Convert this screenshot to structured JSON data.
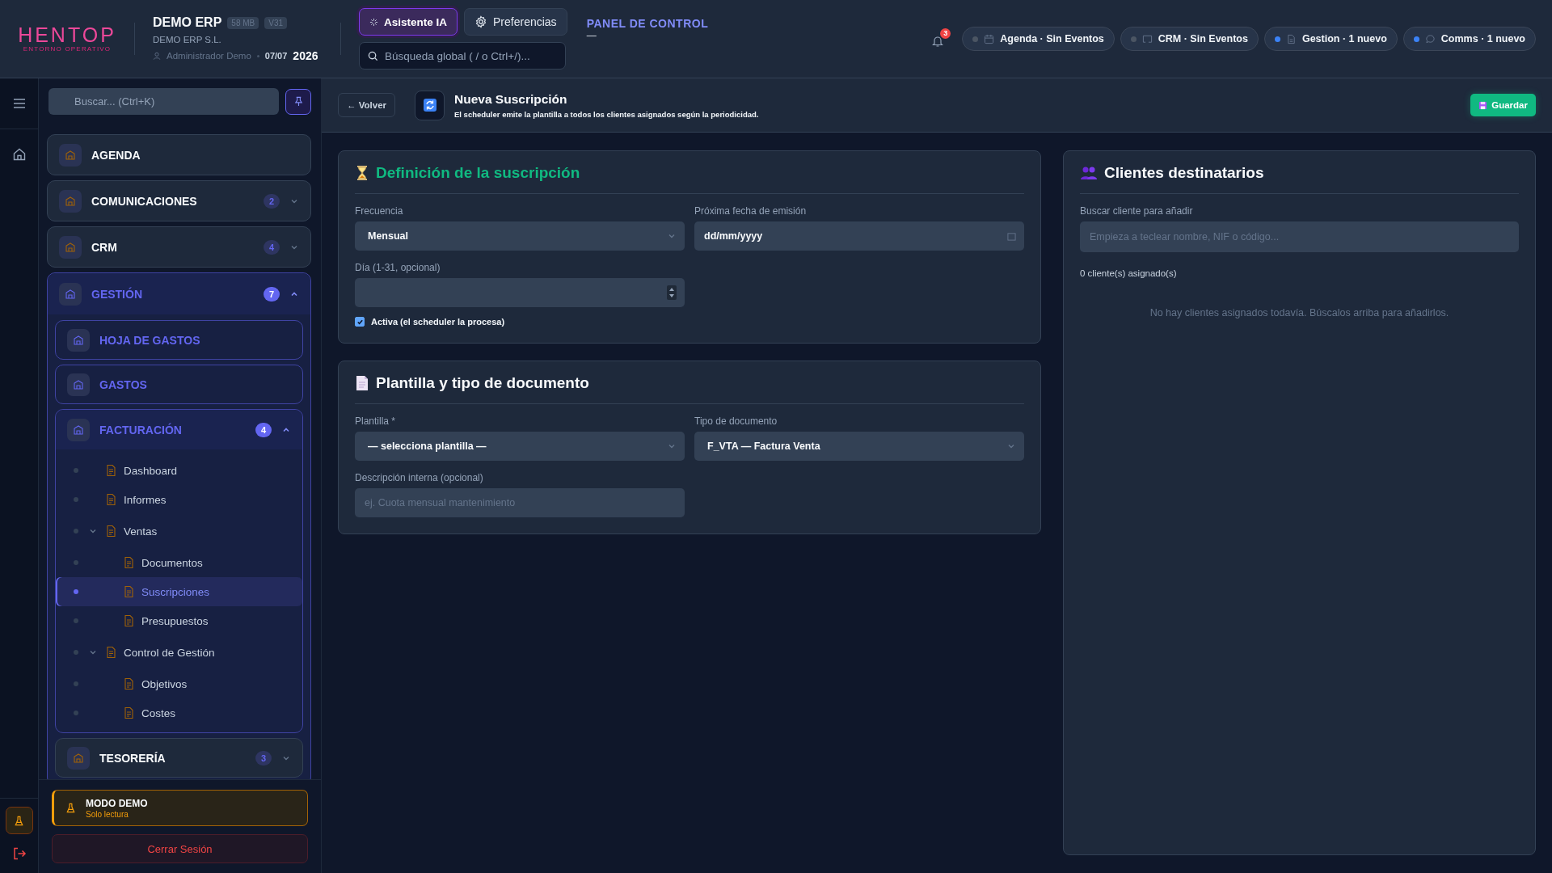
{
  "header": {
    "logo": {
      "name": "HENTOP",
      "tagline": "ENTORNO OPERATIVO"
    },
    "company": {
      "name": "DEMO ERP",
      "badges": [
        "58 MB",
        "V31"
      ],
      "legal_name": "DEMO ERP S.L.",
      "user": "Administrador Demo",
      "date": "07/07",
      "year": "2026"
    },
    "buttons": [
      {
        "label": "Asistente IA",
        "selected": true
      },
      {
        "label": "Preferencias",
        "selected": false
      }
    ],
    "search": {
      "placeholder": "Búsqueda global ( / o Ctrl+/)..."
    },
    "panel_title": "PANEL DE CONTROL",
    "panel_subtitle": "—",
    "notifications": {
      "count": "3"
    },
    "chips": [
      {
        "label": "Agenda · Sin Eventos",
        "color": "#4b5563",
        "kind": "calendar"
      },
      {
        "label": "CRM · Sin Eventos",
        "color": "#4b5563",
        "kind": "screen"
      },
      {
        "label": "Gestion · 1 nuevo",
        "color": "#3b82f6",
        "kind": "document"
      },
      {
        "label": "Comms · 1 nuevo",
        "color": "#3b82f6",
        "kind": "chat"
      }
    ]
  },
  "sidebar": {
    "search": {
      "placeholder": "Buscar... (Ctrl+K)"
    },
    "items": [
      {
        "kind": "section",
        "label": "AGENDA",
        "highlighted": false
      },
      {
        "kind": "section",
        "label": "COMUNICACIONES",
        "badge": "2",
        "expanded": false,
        "highlighted": false
      },
      {
        "kind": "section",
        "label": "CRM",
        "badge": "4",
        "expanded": false,
        "highlighted": false
      },
      {
        "kind": "section",
        "label": "GESTIÓN",
        "badge": "7",
        "expanded": true,
        "highlighted": true,
        "children": [
          {
            "kind": "section",
            "label": "HOJA DE GASTOS",
            "highlighted": true
          },
          {
            "kind": "section",
            "label": "GASTOS",
            "highlighted": true
          },
          {
            "kind": "section",
            "label": "FACTURACIÓN",
            "badge": "4",
            "expanded": true,
            "highlighted": true,
            "children": [
              {
                "kind": "link",
                "label": "Dashboard",
                "selected": false
              },
              {
                "kind": "link",
                "label": "Informes",
                "selected": false
              },
              {
                "kind": "link",
                "label": "Ventas",
                "selected": false,
                "expanded": true,
                "children": [
                  {
                    "kind": "link",
                    "label": "Documentos",
                    "selected": false
                  },
                  {
                    "kind": "link",
                    "label": "Suscripciones",
                    "selected": true
                  },
                  {
                    "kind": "link",
                    "label": "Presupuestos",
                    "selected": false
                  }
                ]
              },
              {
                "kind": "link",
                "label": "Control de Gestión",
                "selected": false,
                "expanded": true,
                "children": [
                  {
                    "kind": "link",
                    "label": "Objetivos",
                    "selected": false
                  },
                  {
                    "kind": "link",
                    "label": "Costes",
                    "selected": false
                  }
                ]
              }
            ]
          },
          {
            "kind": "section",
            "label": "TESORERÍA",
            "badge": "3",
            "expanded": false,
            "highlighted": false
          }
        ]
      }
    ],
    "demo": {
      "title": "MODO DEMO",
      "subtitle": "Solo lectura"
    },
    "logout": "Cerrar Sesión"
  },
  "page": {
    "back": "← Volver",
    "title": "Nueva Suscripción",
    "subtitle": "El scheduler emite la plantilla a todos los clientes asignados según la periodicidad.",
    "save": "Guardar"
  },
  "cards": [
    {
      "title": "Definición de la suscripción",
      "color": "#10b981",
      "kind": "hourglass",
      "fields": [
        {
          "kind": "select",
          "label": "Frecuencia",
          "value": "Mensual"
        },
        {
          "kind": "date",
          "label": "Próxima fecha de emisión",
          "value": "dd/mm/yyyy"
        },
        {
          "kind": "number",
          "label": "Día (1-31, opcional)"
        },
        {
          "kind": "checkbox",
          "label": "Activa (el scheduler la procesa)",
          "checked": true
        }
      ]
    },
    {
      "title": "Plantilla y tipo de documento",
      "color": "#f8fafc",
      "kind": "page",
      "fields": [
        {
          "kind": "select",
          "label": "Plantilla *",
          "value": "— selecciona plantilla —"
        },
        {
          "kind": "select",
          "label": "Tipo de documento",
          "value": "F_VTA — Factura Venta"
        },
        {
          "kind": "text",
          "label": "Descripción interna (opcional)",
          "placeholder": "ej. Cuota mensual mantenimiento"
        }
      ]
    }
  ],
  "clients": {
    "title": "Clientes destinatarios",
    "search_label": "Buscar cliente para añadir",
    "placeholder": "Empieza a teclear nombre, NIF o código...",
    "count": "0 cliente(s) asignado(s)",
    "empty": "No hay clientes asignados todavía. Búscalos arriba para añadirlos."
  }
}
